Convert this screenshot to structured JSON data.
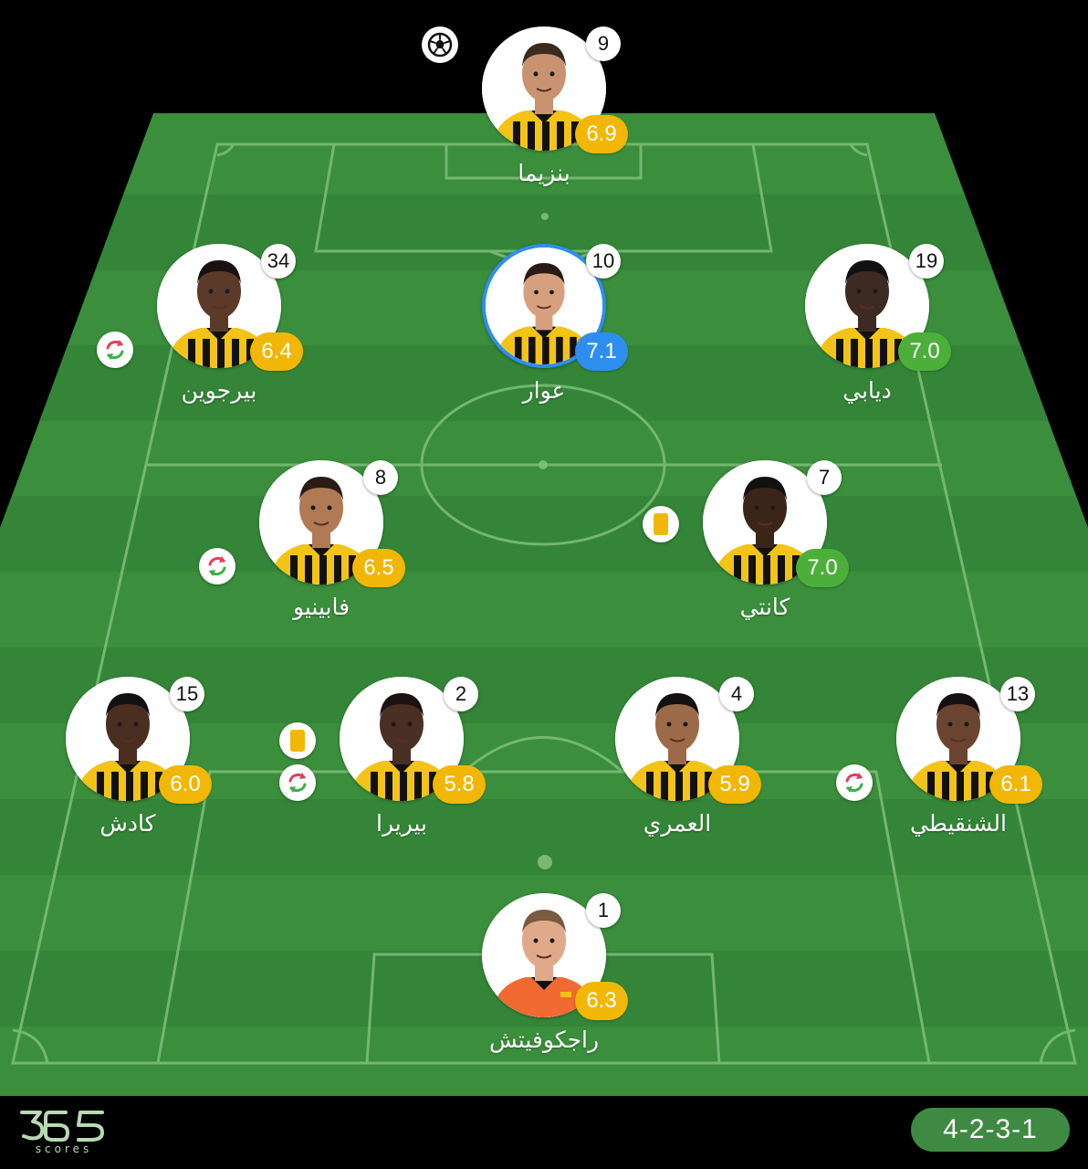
{
  "formation": "4-2-3-1",
  "brand": {
    "name": "365",
    "sub": "scores"
  },
  "colors": {
    "rating_yellow": "#f2b705",
    "rating_green": "#4caf3a",
    "rating_blue": "#2e8ef0",
    "kit_yellow": "#f3c317",
    "kit_black": "#111111",
    "gk_orange": "#f06a32"
  },
  "players": [
    {
      "name": "بنزيما",
      "number": "9",
      "rating": "6.9",
      "rating_color": "yellow",
      "events": [
        "goal-icon"
      ],
      "kit": "outfield",
      "skin": "#c99371",
      "hair": "#3a2a20"
    },
    {
      "name": "بيرجوين",
      "number": "34",
      "rating": "6.4",
      "rating_color": "yellow",
      "events": [
        "substitution-icon"
      ],
      "kit": "outfield",
      "skin": "#5b3a2a",
      "hair": "#1a1110"
    },
    {
      "name": "عوار",
      "number": "10",
      "rating": "7.1",
      "rating_color": "blue",
      "selected": true,
      "events": [],
      "kit": "outfield",
      "skin": "#d6a07e",
      "hair": "#2a1c14"
    },
    {
      "name": "ديابي",
      "number": "19",
      "rating": "7.0",
      "rating_color": "green",
      "events": [],
      "kit": "outfield",
      "skin": "#3d2a22",
      "hair": "#111111"
    },
    {
      "name": "فابينيو",
      "number": "8",
      "rating": "6.5",
      "rating_color": "yellow",
      "events": [
        "substitution-icon"
      ],
      "kit": "outfield",
      "skin": "#b07a55",
      "hair": "#2a1c14"
    },
    {
      "name": "كانتي",
      "number": "7",
      "rating": "7.0",
      "rating_color": "green",
      "events": [
        "yellow-card-icon"
      ],
      "kit": "outfield",
      "skin": "#3b2519",
      "hair": "#111111"
    },
    {
      "name": "كادش",
      "number": "15",
      "rating": "6.0",
      "rating_color": "yellow",
      "events": [],
      "kit": "outfield",
      "skin": "#4a2e20",
      "hair": "#111111"
    },
    {
      "name": "بيريرا",
      "number": "2",
      "rating": "5.8",
      "rating_color": "yellow",
      "events": [
        "yellow-card-icon",
        "substitution-icon"
      ],
      "kit": "outfield",
      "skin": "#4a3024",
      "hair": "#1a1110"
    },
    {
      "name": "العمري",
      "number": "4",
      "rating": "5.9",
      "rating_color": "yellow",
      "events": [],
      "kit": "outfield",
      "skin": "#9c6a48",
      "hair": "#151010"
    },
    {
      "name": "الشنقيطي",
      "number": "13",
      "rating": "6.1",
      "rating_color": "yellow",
      "events": [
        "substitution-icon"
      ],
      "kit": "outfield",
      "skin": "#6a4430",
      "hair": "#151010"
    },
    {
      "name": "راجكوفيتش",
      "number": "1",
      "rating": "6.3",
      "rating_color": "yellow",
      "events": [],
      "kit": "goalkeeper",
      "skin": "#e0aa8a",
      "hair": "#7a5a40"
    }
  ]
}
